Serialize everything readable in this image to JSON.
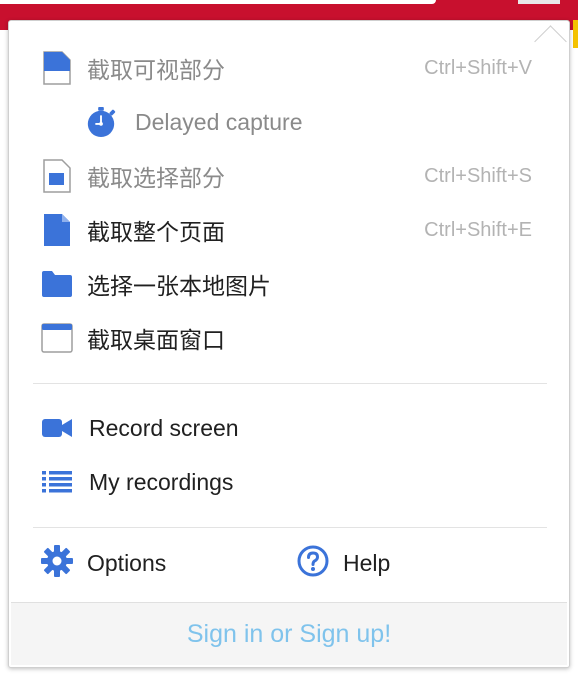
{
  "colors": {
    "accent": "#3b73d9",
    "browser_bar": "#c8102e",
    "link": "#7fc3ec",
    "disabled_text": "#8a8a8a",
    "shortcut_text": "#b3b3b3"
  },
  "menu": {
    "capture_items": [
      {
        "label": "截取可视部分",
        "shortcut": "Ctrl+Shift+V",
        "icon": "visible-part-icon",
        "enabled": false
      },
      {
        "label": "Delayed capture",
        "icon": "timer-icon",
        "enabled": false
      },
      {
        "label": "截取选择部分",
        "shortcut": "Ctrl+Shift+S",
        "icon": "selection-icon",
        "enabled": false
      },
      {
        "label": "截取整个页面",
        "shortcut": "Ctrl+Shift+E",
        "icon": "full-page-icon",
        "enabled": true
      },
      {
        "label": "选择一张本地图片",
        "icon": "folder-icon",
        "enabled": true
      },
      {
        "label": "截取桌面窗口",
        "icon": "window-icon",
        "enabled": true
      }
    ],
    "record_items": [
      {
        "label": "Record screen",
        "icon": "video-camera-icon"
      },
      {
        "label": "My recordings",
        "icon": "list-icon"
      }
    ],
    "options_label": "Options",
    "help_label": "Help",
    "signin_label": "Sign in or Sign up!"
  }
}
